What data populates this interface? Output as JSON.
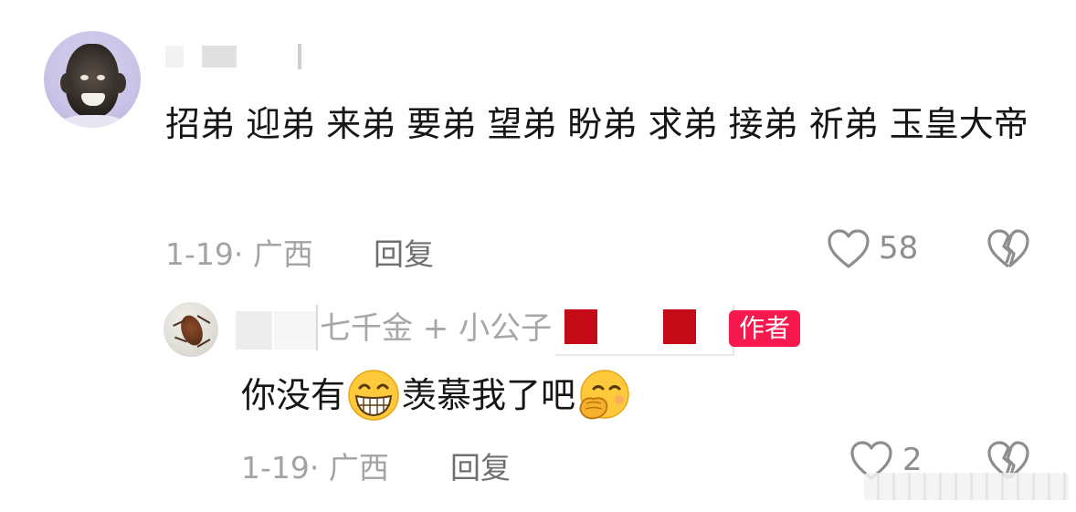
{
  "comment": {
    "avatar": "user-avatar-icon",
    "text": "招弟 迎弟 来弟 要弟 望弟 盼弟 求弟 接弟 祈弟 玉皇大帝",
    "date_location": "1-19· 广西",
    "reply_label": "回复",
    "like_icon": "heart-outline-icon",
    "like_count": "58",
    "dislike_icon": "broken-heart-icon"
  },
  "reply": {
    "avatar": "user-avatar-icon",
    "name_visible": "七千金 + 小公子",
    "author_tag": "作者",
    "text_part1": "你没有",
    "emoji1": "grinning-face-emoji",
    "text_part2": "羡慕我了吧",
    "emoji2": "face-with-hand-over-mouth-emoji",
    "date_location": "1-19· 广西",
    "reply_label": "回复",
    "like_icon": "heart-outline-icon",
    "like_count": "2",
    "dislike_icon": "broken-heart-icon"
  },
  "colors": {
    "author_tag_bg": "#f5194e",
    "flag_red": "#c40b17",
    "text": "#161616",
    "meta": "#a3a3a3"
  }
}
